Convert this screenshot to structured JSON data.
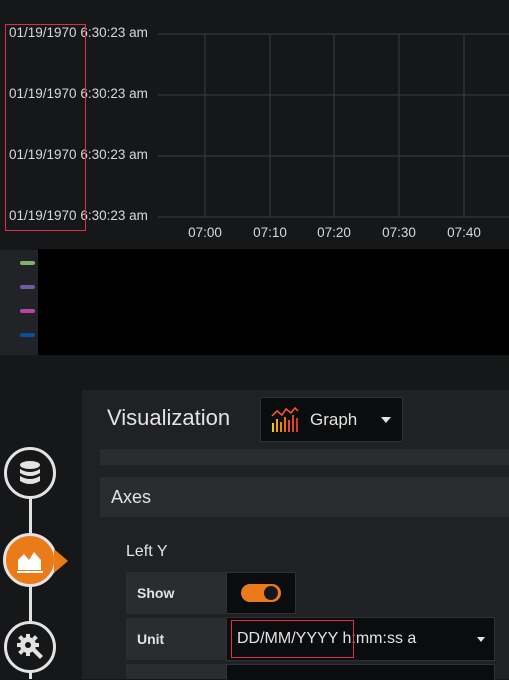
{
  "graph": {
    "y_tick_labels": [
      "01/19/1970 6:30:23 am",
      "01/19/1970 6:30:23 am",
      "01/19/1970 6:30:23 am",
      "01/19/1970 6:30:23 am"
    ],
    "x_tick_labels": [
      "07:00",
      "07:10",
      "07:20",
      "07:30",
      "07:40"
    ]
  },
  "legend": {
    "swatch_colors": [
      "#7eb26d",
      "#705da0",
      "#ba43a9",
      "#0a50a1"
    ]
  },
  "editor": {
    "visualization_label": "Visualization",
    "visualization_value": "Graph",
    "axes_section_title": "Axes",
    "left_y_label": "Left Y",
    "show_label": "Show",
    "show_toggle_on": true,
    "unit_label": "Unit",
    "unit_value_highlight": "DD/MM/YYYY",
    "unit_value_rest": " h:mm:ss a"
  },
  "rail": {
    "icons": [
      "database-icon",
      "chart-icon",
      "gear-icon"
    ],
    "active": "chart-icon",
    "accent_color": "#eb7b18"
  }
}
